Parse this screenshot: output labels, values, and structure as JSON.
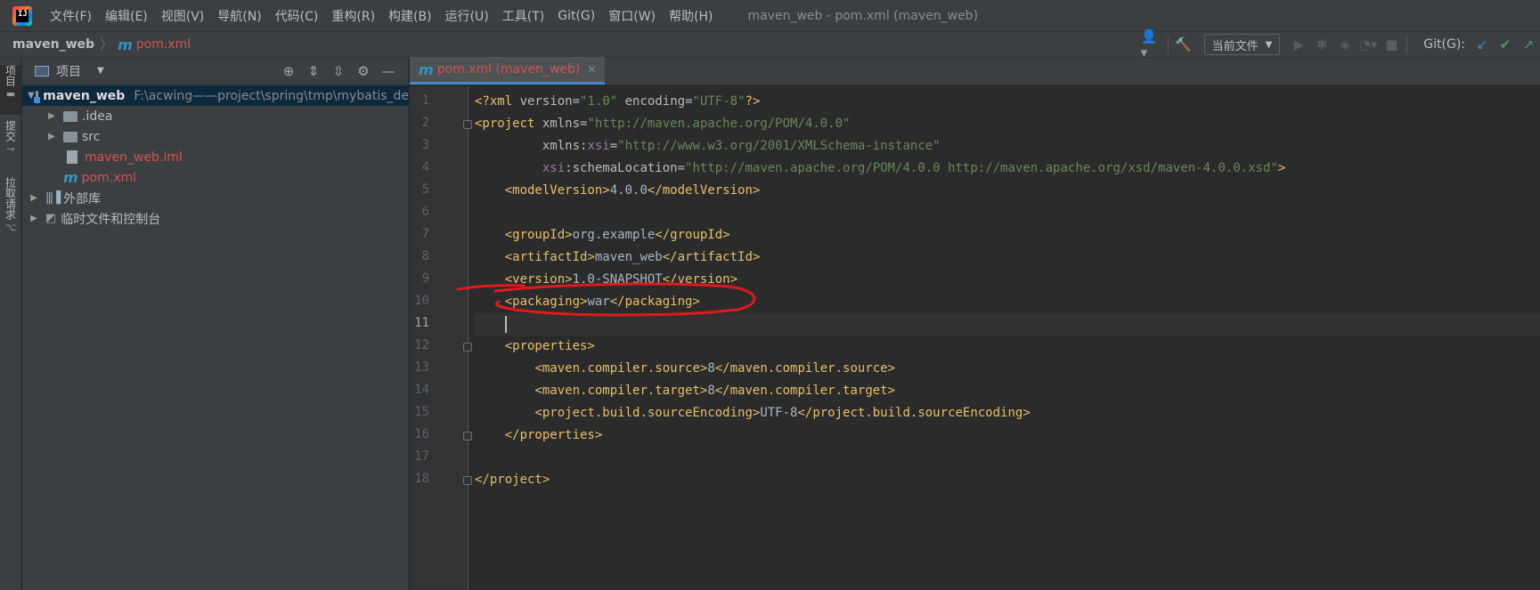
{
  "menubar": {
    "items": [
      "文件(F)",
      "编辑(E)",
      "视图(V)",
      "导航(N)",
      "代码(C)",
      "重构(R)",
      "构建(B)",
      "运行(U)",
      "工具(T)",
      "Git(G)",
      "窗口(W)",
      "帮助(H)"
    ],
    "window_title": "maven_web - pom.xml (maven_web)",
    "logo_text": "IJ"
  },
  "navbar": {
    "project": "maven_web",
    "file": "pom.xml",
    "run_config": "当前文件",
    "git_label": "Git(G):"
  },
  "left_stripe": {
    "tabs": [
      "项目",
      "提交",
      "拉取请求"
    ]
  },
  "project_panel": {
    "title": "项目",
    "tree": [
      {
        "label": "maven_web",
        "path": "F:\\acwing——project\\spring\\tmp\\mybatis_de"
      },
      {
        "label": ".idea"
      },
      {
        "label": "src"
      },
      {
        "label": "maven_web.iml"
      },
      {
        "label": "pom.xml"
      },
      {
        "label": "外部库"
      },
      {
        "label": "临时文件和控制台"
      }
    ]
  },
  "editor": {
    "tab_label": "pom.xml (maven_web)",
    "line_numbers": [
      "1",
      "2",
      "3",
      "4",
      "5",
      "6",
      "7",
      "8",
      "9",
      "10",
      "11",
      "12",
      "13",
      "14",
      "15",
      "16",
      "17",
      "18"
    ],
    "current_line": 11,
    "lines": [
      [
        {
          "c": "t-tag",
          "t": "<?xml "
        },
        {
          "c": "t-attr",
          "t": "version"
        },
        {
          "c": "t-text",
          "t": "="
        },
        {
          "c": "t-val",
          "t": "\"1.0\""
        },
        {
          "c": "t-text",
          "t": " "
        },
        {
          "c": "t-attr",
          "t": "encoding"
        },
        {
          "c": "t-text",
          "t": "="
        },
        {
          "c": "t-val",
          "t": "\"UTF-8\""
        },
        {
          "c": "t-tag",
          "t": "?>"
        }
      ],
      [
        {
          "c": "t-tag",
          "t": "<project "
        },
        {
          "c": "t-attr",
          "t": "xmlns"
        },
        {
          "c": "t-text",
          "t": "="
        },
        {
          "c": "t-val",
          "t": "\"http://maven.apache.org/POM/4.0.0\""
        }
      ],
      [
        {
          "c": "t-text",
          "t": "         "
        },
        {
          "c": "t-attr",
          "t": "xmlns:"
        },
        {
          "c": "t-ns",
          "t": "xsi"
        },
        {
          "c": "t-text",
          "t": "="
        },
        {
          "c": "t-val",
          "t": "\"http://www.w3.org/2001/XMLSchema-instance\""
        }
      ],
      [
        {
          "c": "t-text",
          "t": "         "
        },
        {
          "c": "t-ns",
          "t": "xsi"
        },
        {
          "c": "t-attr",
          "t": ":schemaLocation"
        },
        {
          "c": "t-text",
          "t": "="
        },
        {
          "c": "t-val",
          "t": "\"http://maven.apache.org/POM/4.0.0 http://maven.apache.org/xsd/maven-4.0.0.xsd\""
        },
        {
          "c": "t-tag",
          "t": ">"
        }
      ],
      [
        {
          "c": "t-text",
          "t": "    "
        },
        {
          "c": "t-tag",
          "t": "<modelVersion>"
        },
        {
          "c": "t-text",
          "t": "4.0.0"
        },
        {
          "c": "t-tag",
          "t": "</modelVersion>"
        }
      ],
      [],
      [
        {
          "c": "t-text",
          "t": "    "
        },
        {
          "c": "t-tag",
          "t": "<groupId>"
        },
        {
          "c": "t-text",
          "t": "org.example"
        },
        {
          "c": "t-tag",
          "t": "</groupId>"
        }
      ],
      [
        {
          "c": "t-text",
          "t": "    "
        },
        {
          "c": "t-tag",
          "t": "<artifactId>"
        },
        {
          "c": "t-text",
          "t": "maven_web"
        },
        {
          "c": "t-tag",
          "t": "</artifactId>"
        }
      ],
      [
        {
          "c": "t-text",
          "t": "    "
        },
        {
          "c": "t-tag",
          "t": "<version>"
        },
        {
          "c": "t-text",
          "t": "1.0-SNAPSHOT"
        },
        {
          "c": "t-tag",
          "t": "</version>"
        }
      ],
      [
        {
          "c": "t-text",
          "t": "    "
        },
        {
          "c": "t-tag",
          "t": "<packaging>"
        },
        {
          "c": "t-text",
          "t": "war"
        },
        {
          "c": "t-tag",
          "t": "</packaging>"
        }
      ],
      [],
      [
        {
          "c": "t-text",
          "t": "    "
        },
        {
          "c": "t-tag",
          "t": "<properties>"
        }
      ],
      [
        {
          "c": "t-text",
          "t": "        "
        },
        {
          "c": "t-tag",
          "t": "<maven.compiler.source>"
        },
        {
          "c": "t-text",
          "t": "8"
        },
        {
          "c": "t-tag",
          "t": "</maven.compiler.source>"
        }
      ],
      [
        {
          "c": "t-text",
          "t": "        "
        },
        {
          "c": "t-tag",
          "t": "<maven.compiler.target>"
        },
        {
          "c": "t-text",
          "t": "8"
        },
        {
          "c": "t-tag",
          "t": "</maven.compiler.target>"
        }
      ],
      [
        {
          "c": "t-text",
          "t": "        "
        },
        {
          "c": "t-tag",
          "t": "<project.build.sourceEncoding>"
        },
        {
          "c": "t-text",
          "t": "UTF-8"
        },
        {
          "c": "t-tag",
          "t": "</project.build.sourceEncoding>"
        }
      ],
      [
        {
          "c": "t-text",
          "t": "    "
        },
        {
          "c": "t-tag",
          "t": "</properties>"
        }
      ],
      [],
      [
        {
          "c": "t-tag",
          "t": "</project>"
        }
      ]
    ]
  },
  "colors": {
    "annotation_red": "#e0191c",
    "modified_file": "#d25252",
    "accent_blue": "#4a88c7"
  }
}
